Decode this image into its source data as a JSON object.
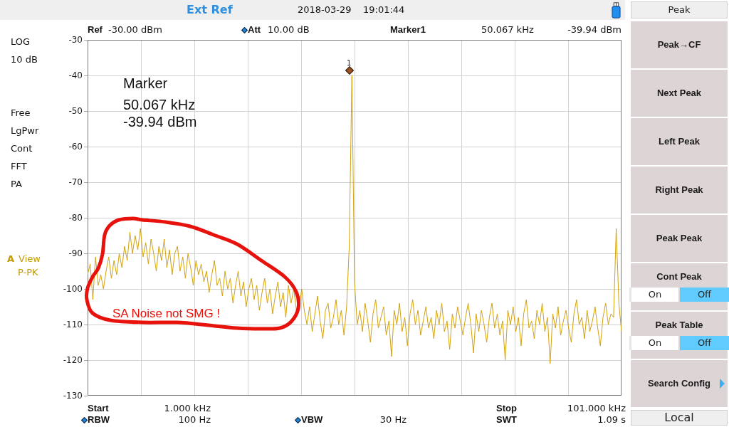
{
  "status_bar": {
    "reference": "Ext Ref",
    "date": "2018-03-29",
    "time": "19:01:44"
  },
  "left_panel": {
    "scale": [
      "LOG",
      "10 dB"
    ],
    "settings": [
      "Free",
      "LgPwr",
      "Cont",
      "FFT",
      "PA"
    ],
    "trace": {
      "mode": "View",
      "detector": "P-PK"
    }
  },
  "header": {
    "ref": {
      "label": "Ref",
      "value": "-30.00 dBm",
      "manual": false
    },
    "att": {
      "label": "Att",
      "value": "10.00 dB",
      "manual": true
    },
    "marker": {
      "label": "Marker1",
      "frequency": "50.067 kHz",
      "level": "-39.94 dBm"
    }
  },
  "plot": {
    "chart_data": {
      "type": "line",
      "ylim": [
        -130,
        -30
      ],
      "yticks": [
        -30,
        -40,
        -50,
        -60,
        -70,
        -80,
        -90,
        -100,
        -110,
        -120,
        -130
      ],
      "grid": true,
      "series": [
        {
          "name": "A",
          "color": "#d4a20a",
          "values": [
            -96,
            -93,
            -103,
            -91,
            -99,
            -96,
            -100,
            -95,
            -91,
            -97,
            -92,
            -96,
            -90,
            -94,
            -88,
            -92,
            -84,
            -90,
            -85,
            -89,
            -83,
            -91,
            -87,
            -93,
            -86,
            -90,
            -95,
            -88,
            -92,
            -86,
            -94,
            -89,
            -96,
            -90,
            -88,
            -95,
            -91,
            -97,
            -90,
            -94,
            -99,
            -92,
            -96,
            -93,
            -98,
            -95,
            -101,
            -96,
            -92,
            -99,
            -97,
            -102,
            -95,
            -100,
            -97,
            -104,
            -99,
            -95,
            -102,
            -98,
            -105,
            -100,
            -97,
            -103,
            -99,
            -106,
            -101,
            -97,
            -104,
            -100,
            -107,
            -102,
            -98,
            -105,
            -101,
            -108,
            -99,
            -104,
            -100,
            -106,
            -106,
            -100,
            -106,
            -110,
            -105,
            -112,
            -107,
            -102,
            -109,
            -114,
            -106,
            -104,
            -111,
            -108,
            -103,
            -110,
            -106,
            -113,
            -105,
            -88,
            -40,
            -98,
            -110,
            -106,
            -112,
            -104,
            -109,
            -115,
            -107,
            -103,
            -111,
            -108,
            -105,
            -113,
            -109,
            -119,
            -106,
            -110,
            -104,
            -112,
            -108,
            -116,
            -107,
            -103,
            -110,
            -106,
            -113,
            -109,
            -105,
            -111,
            -108,
            -114,
            -106,
            -110,
            -104,
            -112,
            -109,
            -117,
            -107,
            -111,
            -105,
            -109,
            -113,
            -108,
            -104,
            -110,
            -118,
            -107,
            -112,
            -106,
            -110,
            -115,
            -108,
            -104,
            -111,
            -107,
            -113,
            -109,
            -120,
            -106,
            -110,
            -105,
            -112,
            -108,
            -116,
            -107,
            -103,
            -111,
            -109,
            -114,
            -106,
            -110,
            -104,
            -112,
            -108,
            -121,
            -107,
            -111,
            -105,
            -113,
            -109,
            -106,
            -111,
            -115,
            -107,
            -103,
            -110,
            -108,
            -114,
            -106,
            -112,
            -109,
            -105,
            -111,
            -116,
            -108,
            -104,
            -110,
            -107,
            -108,
            -83,
            -104,
            -112
          ]
        }
      ]
    },
    "marker_readout": {
      "title": "Marker",
      "frequency": "50.067 kHz",
      "level": "-39.94 dBm"
    },
    "marker_number": "1",
    "annotation": "SA Noise not SMG !"
  },
  "footer": {
    "start": {
      "label": "Start",
      "value": "1.000 kHz",
      "manual": false
    },
    "stop": {
      "label": "Stop",
      "value": "101.000 kHz",
      "manual": false
    },
    "rbw": {
      "label": "RBW",
      "value": "100 Hz",
      "manual": true
    },
    "vbw": {
      "label": "VBW",
      "value": "30 Hz",
      "manual": true
    },
    "swt": {
      "label": "SWT",
      "value": "1.09 s",
      "manual": false
    }
  },
  "menu": {
    "title": "Peak",
    "keys": [
      {
        "kind": "action",
        "label": "Peak→CF"
      },
      {
        "kind": "action",
        "label": "Next Peak"
      },
      {
        "kind": "action",
        "label": "Left Peak"
      },
      {
        "kind": "action",
        "label": "Right Peak"
      },
      {
        "kind": "action",
        "label": "Peak Peak"
      },
      {
        "kind": "toggle",
        "label": "Cont Peak",
        "options": [
          {
            "label": "On",
            "selected": false
          },
          {
            "label": "Off",
            "selected": true
          }
        ]
      },
      {
        "kind": "toggle",
        "label": "Peak Table",
        "options": [
          {
            "label": "On",
            "selected": false
          },
          {
            "label": "Off",
            "selected": true
          }
        ]
      },
      {
        "kind": "submenu",
        "label": "Search Config"
      }
    ],
    "footer": "Local"
  }
}
